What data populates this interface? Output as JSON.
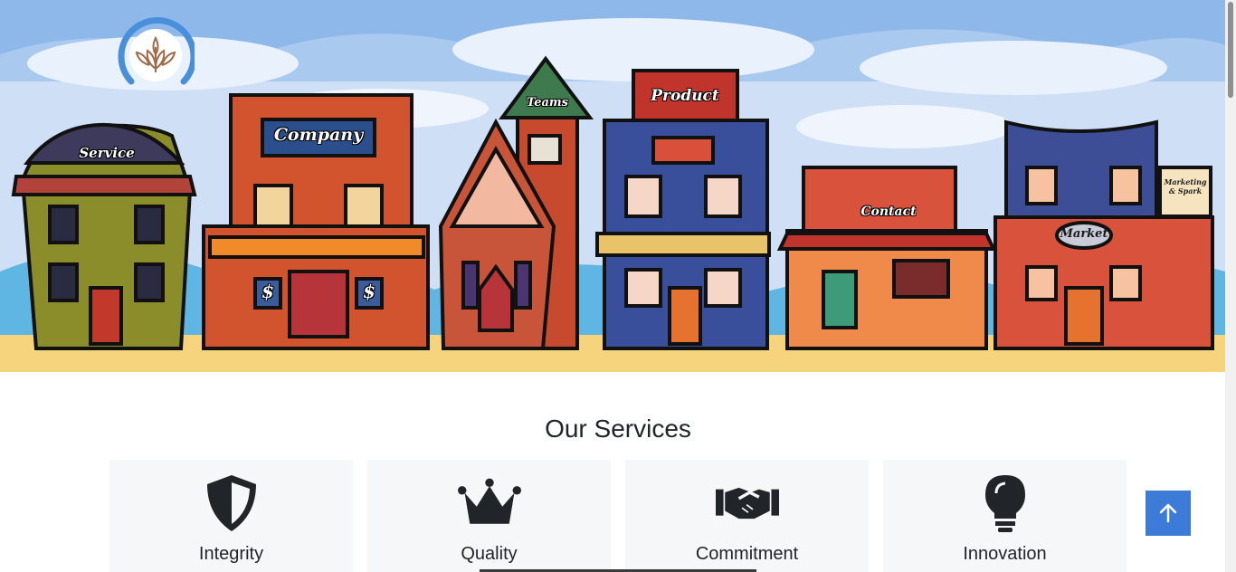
{
  "hero": {
    "signs": {
      "service": "Service",
      "company": "Company",
      "teams": "Teams",
      "product": "Product",
      "contact": "Contact",
      "market": "Market",
      "hanging": "Marketing & Spark"
    },
    "storefront_symbols": [
      "$",
      "$"
    ]
  },
  "services": {
    "title": "Our Services",
    "items": [
      {
        "label": "Integrity",
        "icon": "shield-icon"
      },
      {
        "label": "Quality",
        "icon": "crown-icon"
      },
      {
        "label": "Commitment",
        "icon": "handshake-icon"
      },
      {
        "label": "Innovation",
        "icon": "lightbulb-icon"
      }
    ]
  },
  "back_to_top": {
    "icon": "arrow-up-icon"
  },
  "colors": {
    "accent": "#3d7bd9",
    "logo_ring": "#4a8fdc",
    "logo_leaf": "#a06b4a",
    "card_bg": "#f6f7f8",
    "sky": "#cfe0f6",
    "ground": "#f6d37d"
  }
}
